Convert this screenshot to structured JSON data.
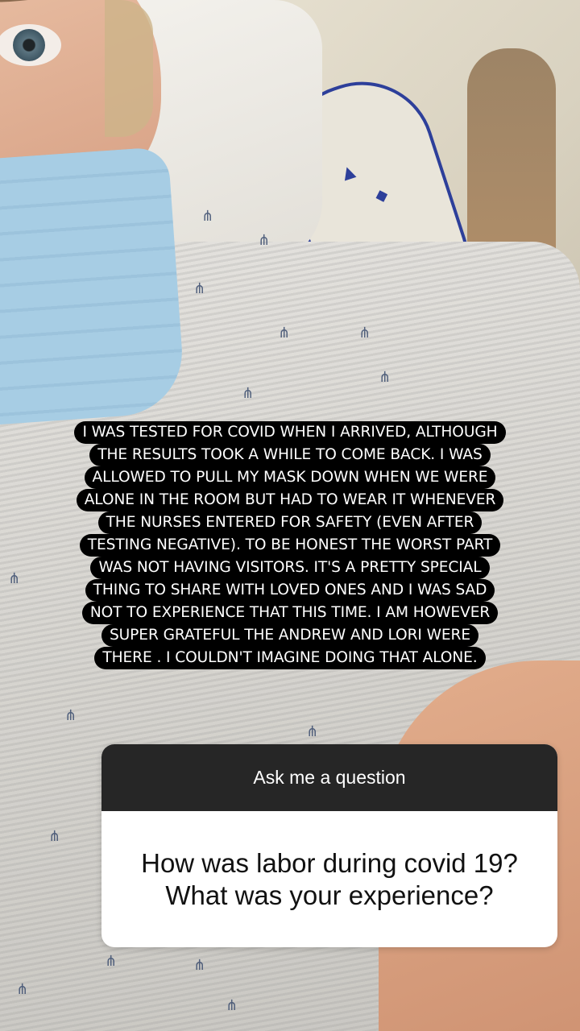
{
  "caption": {
    "lines": [
      "I WAS TESTED FOR COVID WHEN I ARRIVED, ALTHOUGH",
      "THE RESULTS TOOK A WHILE TO COME BACK. I WAS",
      "ALLOWED TO PULL MY MASK DOWN WHEN WE WERE",
      "ALONE IN THE ROOM BUT HAD TO WEAR IT WHENEVER",
      "THE NURSES ENTERED FOR SAFETY (EVEN AFTER",
      "TESTING NEGATIVE). TO BE HONEST THE WORST PART",
      "WAS NOT HAVING VISITORS. IT'S A PRETTY SPECIAL",
      "THING TO SHARE WITH LOVED ONES AND I WAS SAD",
      "NOT TO EXPERIENCE THAT THIS TIME. I AM HOWEVER",
      "SUPER GRATEFUL THE ANDREW AND LORI WERE",
      "THERE . I COULDN'T IMAGINE DOING THAT ALONE."
    ]
  },
  "question_sticker": {
    "header": "Ask me a question",
    "question": "How was labor during covid 19?\nWhat was your experience?",
    "header_color": "#262626",
    "body_color": "#ffffff"
  }
}
